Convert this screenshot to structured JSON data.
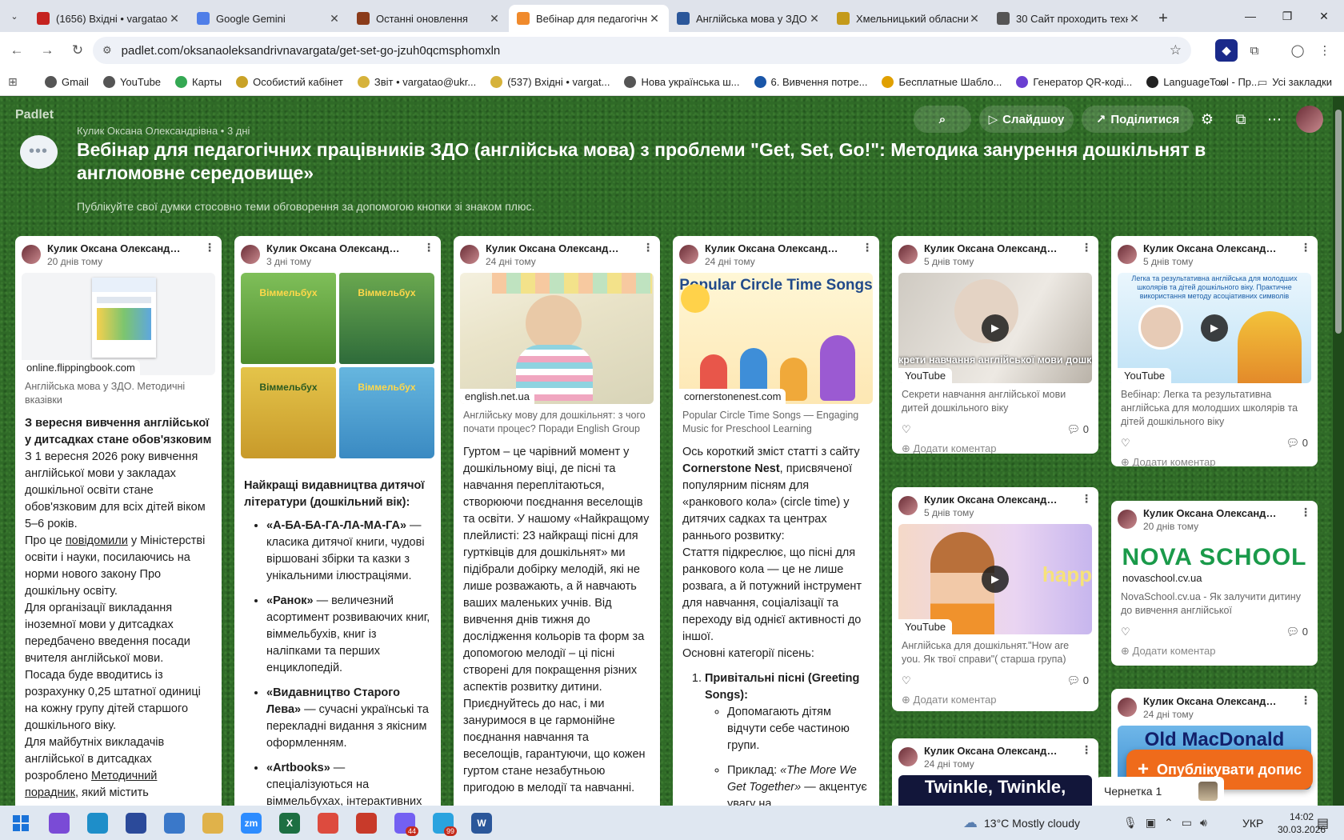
{
  "browser": {
    "tabs": [
      {
        "title": "(1656) Вхідні • vargatao@",
        "icon": "gmail-icon",
        "color": "#c5221f",
        "active": false
      },
      {
        "title": "Google Gemini",
        "icon": "gemini-icon",
        "color": "#4f7ee8",
        "active": false
      },
      {
        "title": "Останні оновлення",
        "icon": "padlet-icon",
        "color": "#8a3b1a",
        "active": false
      },
      {
        "title": "Вебінар для педагогічн",
        "icon": "padlet-icon",
        "color": "#f08a2c",
        "active": true
      },
      {
        "title": "Англійська мова у ЗДО.",
        "icon": "word-icon",
        "color": "#2b579a",
        "active": false
      },
      {
        "title": "Хмельницький обласни",
        "icon": "crest-icon",
        "color": "#c49a1a",
        "active": false
      },
      {
        "title": "30 Сайт проходить техн",
        "icon": "globe-icon",
        "color": "#555555",
        "active": false
      }
    ],
    "url": "padlet.com/oksanaoleksandrivnavargata/get-set-go-jzuh0qcmsphomxln",
    "bookmarks": [
      {
        "label": "Gmail",
        "icon": "globe-icon",
        "color": "#555"
      },
      {
        "label": "YouTube",
        "icon": "globe-icon",
        "color": "#555"
      },
      {
        "label": "Карты",
        "icon": "maps-pin-icon",
        "color": "#34a853"
      },
      {
        "label": "Особистий кабінет",
        "icon": "cabinet-icon",
        "color": "#c9a227"
      },
      {
        "label": "Звіт • vargatao@ukr...",
        "icon": "mail-icon",
        "color": "#d6b23a"
      },
      {
        "label": "(537) Вхідні • vargat...",
        "icon": "mail-icon",
        "color": "#d6b23a"
      },
      {
        "label": "Нова українська ш...",
        "icon": "globe-icon",
        "color": "#555"
      },
      {
        "label": "6. Вивчення потре...",
        "icon": "q-icon",
        "color": "#1a56a8"
      },
      {
        "label": "Бесплатные Шабло...",
        "icon": "smile-icon",
        "color": "#e0a000"
      },
      {
        "label": "Генератор QR-коді...",
        "icon": "qr-icon",
        "color": "#6a3fd1"
      },
      {
        "label": "LanguageTool - Пр...",
        "icon": "lt-icon",
        "color": "#222"
      }
    ],
    "all_bookmarks": "Усі закладки"
  },
  "padlet": {
    "logo": "Padlet",
    "search_icon": "search-icon",
    "slideshow": "Слайдшоу",
    "share": "Поділитися",
    "author_line": "Кулик Оксана Олександрівна • 3 дні",
    "title": "Вебінар для педагогічних працівників ЗДО (англійська мова) з проблеми  \"Get, Set, Go!\": Методика занурення дошкільнят в англомовне середовище»",
    "subtitle": "Публікуйте свої думки стосовно теми обговорення за допомогою кнопки зі знаком плюс.",
    "publish": "Опублікувати допис",
    "draft": "Чернетка 1"
  },
  "posts": {
    "p1": {
      "author": "Кулик Оксана Олександрі...",
      "time": "20 днів тому",
      "domain": "online.flippingbook.com",
      "link_desc": "Англійська мова у ЗДО. Методичні вказівки",
      "heading": "З вересня вивчення англійської у дитсадках стане обов'язковим",
      "t1": "З 1 вересня 2026 року вивчення англійської мови у закладах дошкільної освіти стане обов'язковим для всіх дітей віком 5–6 років.",
      "t2a": "Про це ",
      "t2link": "повідомили",
      "t2b": " у Міністерстві освіти і науки, посилаючись на норми нового закону Про дошкільну освіту.",
      "t3": "Для організації викладання іноземної мови у дитсадках передбачено введення посади вчителя англійської мови.",
      "t4": "Посада буде вводитись із розрахунку 0,25 штатної одиниці на кожну групу дітей старшого дошкільного віку.",
      "t5a": "Для майбутніх викладачів англійської в дитсадках розроблено ",
      "t5link": "Методичний порадник",
      ", ": "",
      "t5b": ", який містить"
    },
    "p2": {
      "author": "Кулик Оксана Олександрі...",
      "time": "3 дні тому",
      "heading": "Найкращі видавництва дитячої літератури (дошкільний вік):",
      "li1b": "«А-БА-БА-ГА-ЛА-МА-ГА»",
      "li1": " — класика дитячої книги, чудові віршовані збірки та казки з унікальними ілюстраціями.",
      "li2b": "«Ранок»",
      "li2": " — величезний асортимент розвиваючих книг, віммельбухів, книг із наліпками та перших енциклопедій.",
      "li3b": "«Видавництво Старого Лева»",
      "li3": " — сучасні українські та перекладні видання з якісним оформленням.",
      "li4b": "«Artbooks»",
      "li4": " — спеціалізуються на віммельбухах, інтерактивних",
      "books": [
        "Віммельбух",
        "Віммельбух",
        "Віммельбух",
        "Віммельбух"
      ]
    },
    "p3": {
      "author": "Кулик Оксана Олександрі...",
      "time": "24 дні тому",
      "domain": "english.net.ua",
      "link_desc": "Англійську мову для дошкільнят: з чого почати процес? Поради English Group",
      "body": "Гуртом – це чарівний момент у дошкільному віці, де пісні та навчання переплітаються, створюючи поєднання веселощів та освіти. У нашому «Найкращому плейлисті: 23 найкращі пісні для гуртківців для дошкільнят» ми підібрали добірку мелодій, які не лише розважають, а й навчають ваших маленьких учнів. Від вивчення днів тижня до дослідження кольорів та форм за допомогою мелодії – ці пісні створені для покращення різних аспектів розвитку дитини. Приєднуйтесь до нас, і ми зануримося в це гармонійне поєднання навчання та веселощів, гарантуючи, що кожен гуртом стане незабутньою пригодою в мелодії та навчанні."
    },
    "p4": {
      "author": "Кулик Оксана Олександрі...",
      "time": "24 дні тому",
      "domain": "cornerstonenest.com",
      "img_title": "Popular Circle Time Songs",
      "link_desc": "Popular Circle Time Songs — Engaging Music for Preschool Learning",
      "t1": "Ось короткий зміст статті з сайту ",
      "t1b": "Cornerstone Nest",
      ", ": "",
      "t1c": ", присвяченої популярним пісням для «ранкового кола» (circle time) у дитячих садках та центрах раннього розвитку:",
      "t2": "Стаття підкреслює, що пісні для ранкового кола — це не лише розвага, а й потужний інструмент для навчання, соціалізації та переходу від однієї активності до іншої.",
      "t3": "Основні категорії пісень:",
      "ol1": "Привітальні пісні (Greeting Songs):",
      "ul1": "Допомагають дітям відчути себе частиною групи.",
      "ul2a": "Приклад: ",
      "ul2i": "«The More We Get Together»",
      "ul2b": " — акцентує увагу на"
    },
    "p5": {
      "author": "Кулик Оксана Олександрі...",
      "time": "5 днів тому",
      "yt": "YouTube",
      "overlay": "крети навчання англійської мови дошкільного віку",
      "link_desc": "Секрети навчання англійської мови дитей дошкільного віку",
      "comments": "0",
      "add_comment": "Додати коментар"
    },
    "p6": {
      "author": "Кулик Оксана Олександрі...",
      "time": "5 днів тому",
      "yt": "YouTube",
      "overlay": "happ",
      "link_desc": "Англійська для дошкільнят.\"How are you. Як твої справи\"( старша група)",
      "comments": "0",
      "add_comment": "Додати коментар"
    },
    "p7": {
      "author": "Кулик Оксана Олександрі...",
      "time": "24 дні тому",
      "img_text": "Twinkle, Twinkle,"
    },
    "p8": {
      "author": "Кулик Оксана Олександрі...",
      "time": "5 днів тому",
      "yt": "YouTube",
      "overlay": "Легка та результативна англійська для молодших школярів та дітей дошкільного віку. Практичне використання методу асоціативних символів",
      "link_desc": "Вебінар: Легка та результативна англійська для молодших школярів та дітей дошкільного віку",
      "comments": "0",
      "add_comment": "Додати коментар"
    },
    "p9": {
      "author": "Кулик Оксана Олександрі...",
      "time": "20 днів тому",
      "domain": "novaschool.cv.ua",
      "img_text": "NOVA SCHOOL",
      "link_desc": "NovaSchool.cv.ua - Як залучити дитину до вивчення англійської",
      "comments": "0",
      "add_comment": "Додати коментар"
    },
    "p10": {
      "author": "Кулик Оксана Олександрі...",
      "time": "24 дні тому",
      "img_text": "Old MacDonald"
    }
  },
  "taskbar": {
    "apps": [
      {
        "name": "copilot-icon",
        "color": "#7a4bd6"
      },
      {
        "name": "edge-icon",
        "color": "#1e8ec9"
      },
      {
        "name": "save-icon",
        "color": "#2b4a9a"
      },
      {
        "name": "globe-icon",
        "color": "#3a78c9"
      },
      {
        "name": "folder-icon",
        "color": "#e0b24a"
      },
      {
        "name": "zoom-icon",
        "color": "#2d8cff",
        "label": "zm"
      },
      {
        "name": "excel-icon",
        "color": "#1d6f42",
        "label": "X"
      },
      {
        "name": "chrome-icon",
        "color": "#dd4b3e"
      },
      {
        "name": "app-red-icon",
        "color": "#c83a2a"
      },
      {
        "name": "viber-icon",
        "color": "#7360f2",
        "badge": "44"
      },
      {
        "name": "telegram-icon",
        "color": "#2aa3df",
        "badge": "99"
      },
      {
        "name": "word-icon",
        "color": "#2b579a",
        "label": "W"
      }
    ],
    "weather": "13°C  Mostly cloudy",
    "lang": "УКР",
    "time": "14:02",
    "date": "30.03.2026"
  }
}
